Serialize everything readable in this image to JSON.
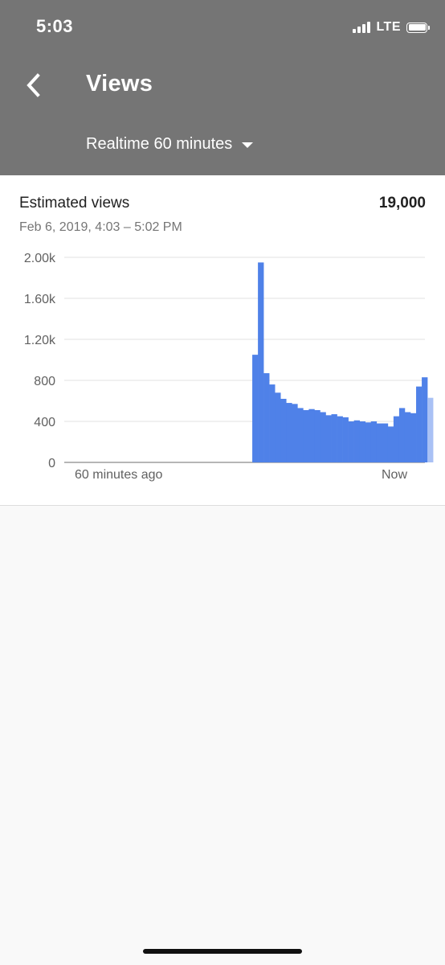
{
  "status_bar": {
    "time": "5:03",
    "network": "LTE",
    "icons": [
      "signal-icon",
      "battery-icon"
    ]
  },
  "header": {
    "title": "Views",
    "back_icon": "chevron-left-icon",
    "range_selector": {
      "selected": "Realtime 60 minutes",
      "icon": "caret-down-icon"
    }
  },
  "card": {
    "metric_label": "Estimated views",
    "metric_value": "19,000",
    "date_range": "Feb 6, 2019, 4:03 – 5:02 PM"
  },
  "colors": {
    "header_bg": "#757575",
    "bar": "#4f81e8",
    "bar_partial": "#a9c1f5"
  },
  "chart_data": {
    "type": "bar",
    "ylim": [
      0,
      2000
    ],
    "yticks": [
      {
        "value": 0,
        "label": "0"
      },
      {
        "value": 400,
        "label": "400"
      },
      {
        "value": 800,
        "label": "800"
      },
      {
        "value": 1200,
        "label": "1.20k"
      },
      {
        "value": 1600,
        "label": "1.60k"
      },
      {
        "value": 2000,
        "label": "2.00k"
      }
    ],
    "x_labels": {
      "start": "60 minutes ago",
      "end": "Now"
    },
    "grid": true,
    "slots": 60,
    "values": [
      0,
      0,
      0,
      0,
      0,
      0,
      0,
      0,
      0,
      0,
      0,
      0,
      0,
      0,
      0,
      0,
      0,
      0,
      0,
      0,
      0,
      0,
      0,
      0,
      0,
      0,
      0,
      0,
      0,
      0,
      0,
      0,
      1050,
      1950,
      870,
      760,
      680,
      620,
      580,
      570,
      530,
      510,
      520,
      510,
      490,
      460,
      470,
      450,
      440,
      400,
      410,
      400,
      390,
      400,
      380,
      380,
      350,
      450,
      530,
      490,
      480,
      740,
      830,
      630
    ],
    "partial_last": true
  }
}
